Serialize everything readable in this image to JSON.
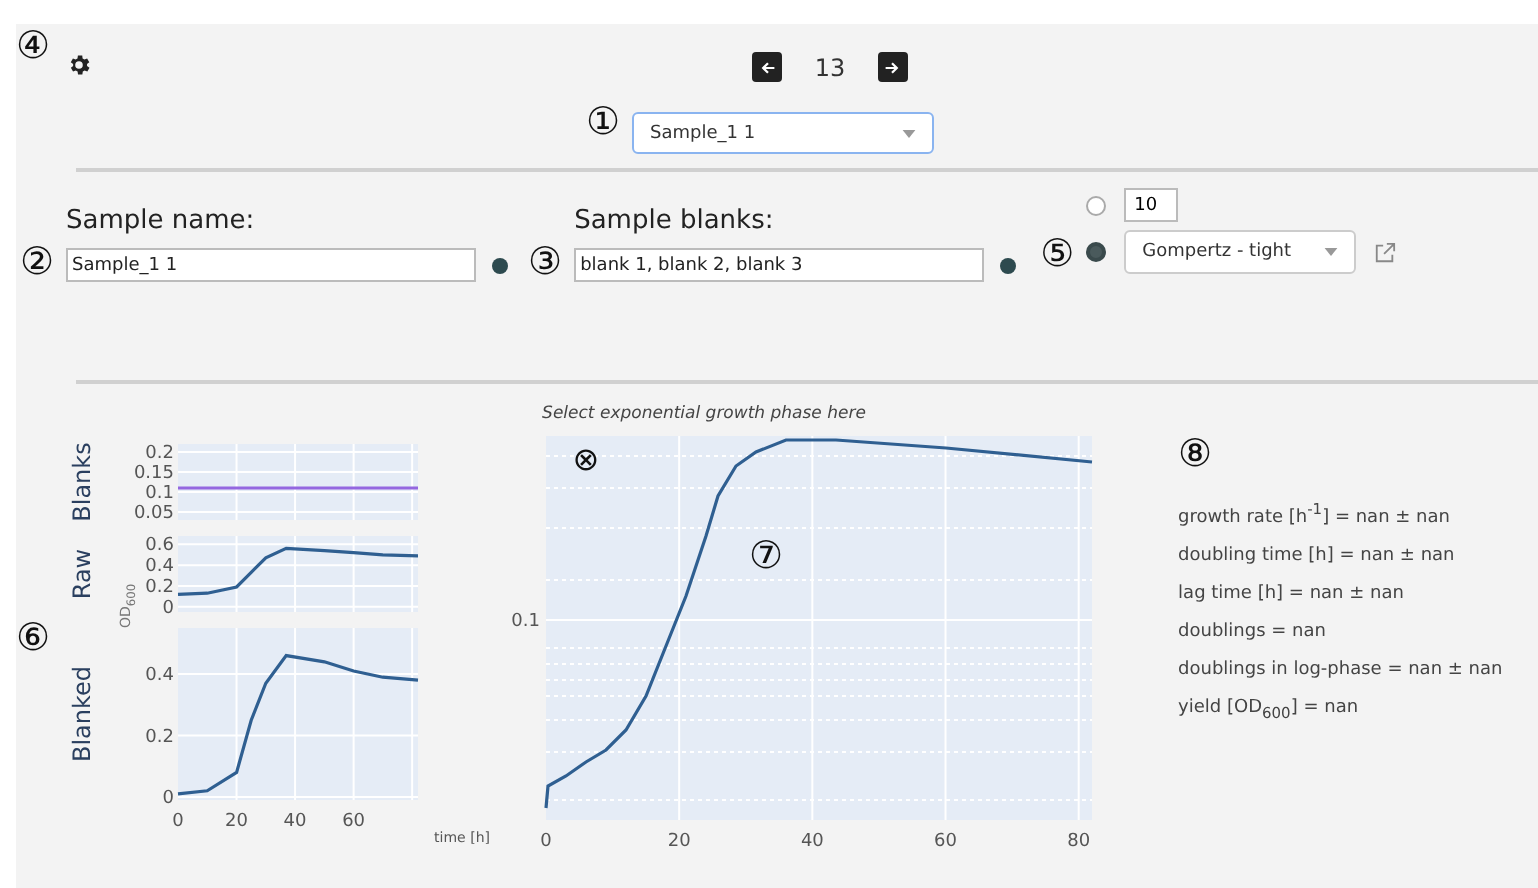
{
  "header": {
    "marker": "④",
    "marker_nav": "①",
    "page_number": "13",
    "sample_select": {
      "value": "Sample_1 1"
    }
  },
  "sample": {
    "marker": "②",
    "label": "Sample name:",
    "value": "Sample_1 1"
  },
  "blanks": {
    "marker": "③",
    "label": "Sample blanks:",
    "value": "blank 1, blank 2, blank 3"
  },
  "fit": {
    "marker": "⑤",
    "options": [
      {
        "kind": "number",
        "selected": false,
        "value": "10"
      },
      {
        "kind": "select",
        "selected": true,
        "value": "Gompertz - tight"
      }
    ]
  },
  "small_plots": {
    "marker": "⑥",
    "axis_unit": "OD$_{600}$",
    "time_label": "time [h]",
    "charts": [
      {
        "chart_data": {
          "type": "line",
          "ylabel": "Blanks",
          "x": [
            0,
            10,
            20,
            25,
            30,
            37,
            50,
            60,
            70,
            82
          ],
          "grid": true,
          "series": [
            {
              "color": "#9467e0",
              "values": [
                0.11,
                0.11,
                0.11,
                0.11,
                0.11,
                0.11,
                0.11,
                0.11,
                0.11,
                0.11
              ]
            }
          ],
          "xlim": [
            0,
            82
          ],
          "ylim": [
            0.03,
            0.22
          ],
          "yticks": [
            0.2,
            0.15,
            0.1,
            0.05
          ]
        }
      },
      {
        "chart_data": {
          "type": "line",
          "ylabel": "Raw",
          "x": [
            0,
            10,
            20,
            25,
            30,
            37,
            50,
            60,
            70,
            82
          ],
          "grid": true,
          "series": [
            {
              "color": "#2f5f91",
              "values": [
                0.12,
                0.13,
                0.19,
                0.33,
                0.47,
                0.56,
                0.54,
                0.52,
                0.5,
                0.49
              ]
            }
          ],
          "xlim": [
            0,
            82
          ],
          "ylim": [
            -0.05,
            0.68
          ],
          "yticks": [
            0.6,
            0.4,
            0.2,
            0
          ]
        }
      },
      {
        "chart_data": {
          "type": "line",
          "ylabel": "Blanked",
          "x": [
            0,
            10,
            20,
            25,
            30,
            37,
            50,
            60,
            70,
            82
          ],
          "grid": true,
          "series": [
            {
              "color": "#2f5f91",
              "values": [
                0.01,
                0.02,
                0.08,
                0.25,
                0.37,
                0.46,
                0.44,
                0.41,
                0.39,
                0.38
              ]
            }
          ],
          "xlim": [
            0,
            82
          ],
          "ylim": [
            -0.01,
            0.55
          ],
          "yticks": [
            0.4,
            0.2,
            0
          ],
          "xticks": [
            0,
            20,
            40,
            60
          ]
        }
      }
    ]
  },
  "main_plot": {
    "title": "Select exponential growth phase here",
    "reset_mark": "⊗",
    "marker": "⑦",
    "y_tick_labels": [
      "0.1"
    ],
    "x_tick_labels": [
      "0",
      "20",
      "40",
      "60",
      "80"
    ]
  },
  "results": {
    "marker": "⑧",
    "lines": [
      "growth rate [h$^{-1}$] = nan ± nan",
      "doubling time [h] = nan ± nan",
      "lag time [h] = nan ± nan",
      "doublings = nan",
      "doublings in log-phase = nan ± nan",
      "yield [OD$_{600}$] = nan"
    ]
  }
}
